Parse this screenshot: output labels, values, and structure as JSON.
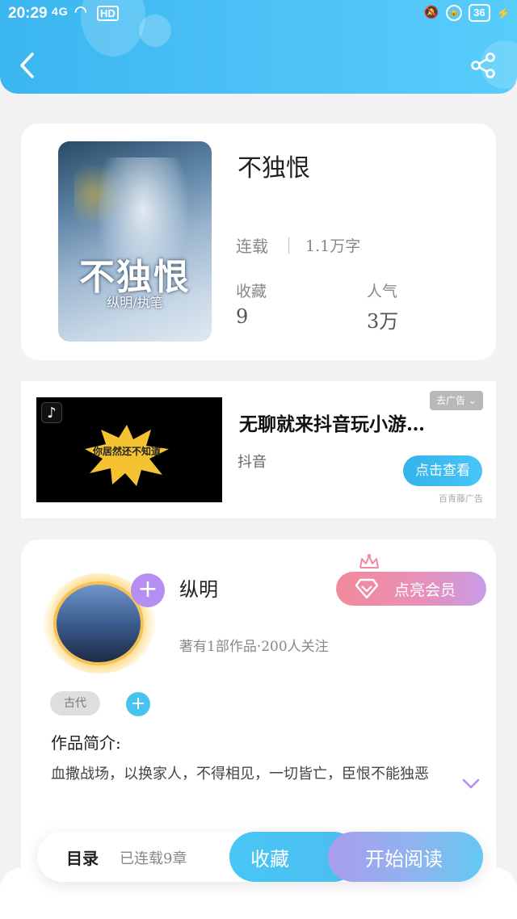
{
  "status_bar": {
    "time": "20:29",
    "signal": "4G",
    "hd": "HD",
    "battery": "36"
  },
  "book": {
    "title": "不独恨",
    "cover_title": "不独恨",
    "cover_author": "纵明/执笔",
    "status": "连载",
    "word_count": "1.1万字",
    "favorites_label": "收藏",
    "favorites_value": "9",
    "popularity_label": "人气",
    "popularity_value": "3万"
  },
  "ad": {
    "close_label": "去广告 ⌄",
    "image_text": "你居然还不知道",
    "title": "无聊就来抖音玩小游…",
    "brand": "抖音",
    "cta": "点击查看",
    "source": "百青藤广告"
  },
  "author": {
    "name": "纵明",
    "vip_button": "点亮会员",
    "meta": "著有1部作品·200人关注",
    "tag": "古代",
    "intro_label": "作品简介:",
    "intro_text": "血撒战场，以换家人，不得相见，一切皆亡，臣恨不能独恶"
  },
  "bottom_bar": {
    "toc_label": "目录",
    "chapter_count": "已连载9章",
    "favorite_button": "收藏",
    "read_button": "开始阅读"
  },
  "colors": {
    "header": "#3ab6f0",
    "accent_blue": "#48c3f0",
    "vip_pink": "#f28a9a",
    "vip_purple": "#c99be6"
  },
  "icons": {
    "back": "back-arrow-icon",
    "share": "share-icon",
    "avatar_add": "plus-icon",
    "tag_add": "plus-icon",
    "vip": "diamond-icon",
    "crown": "crown-icon",
    "expand": "chevron-down-icon"
  }
}
